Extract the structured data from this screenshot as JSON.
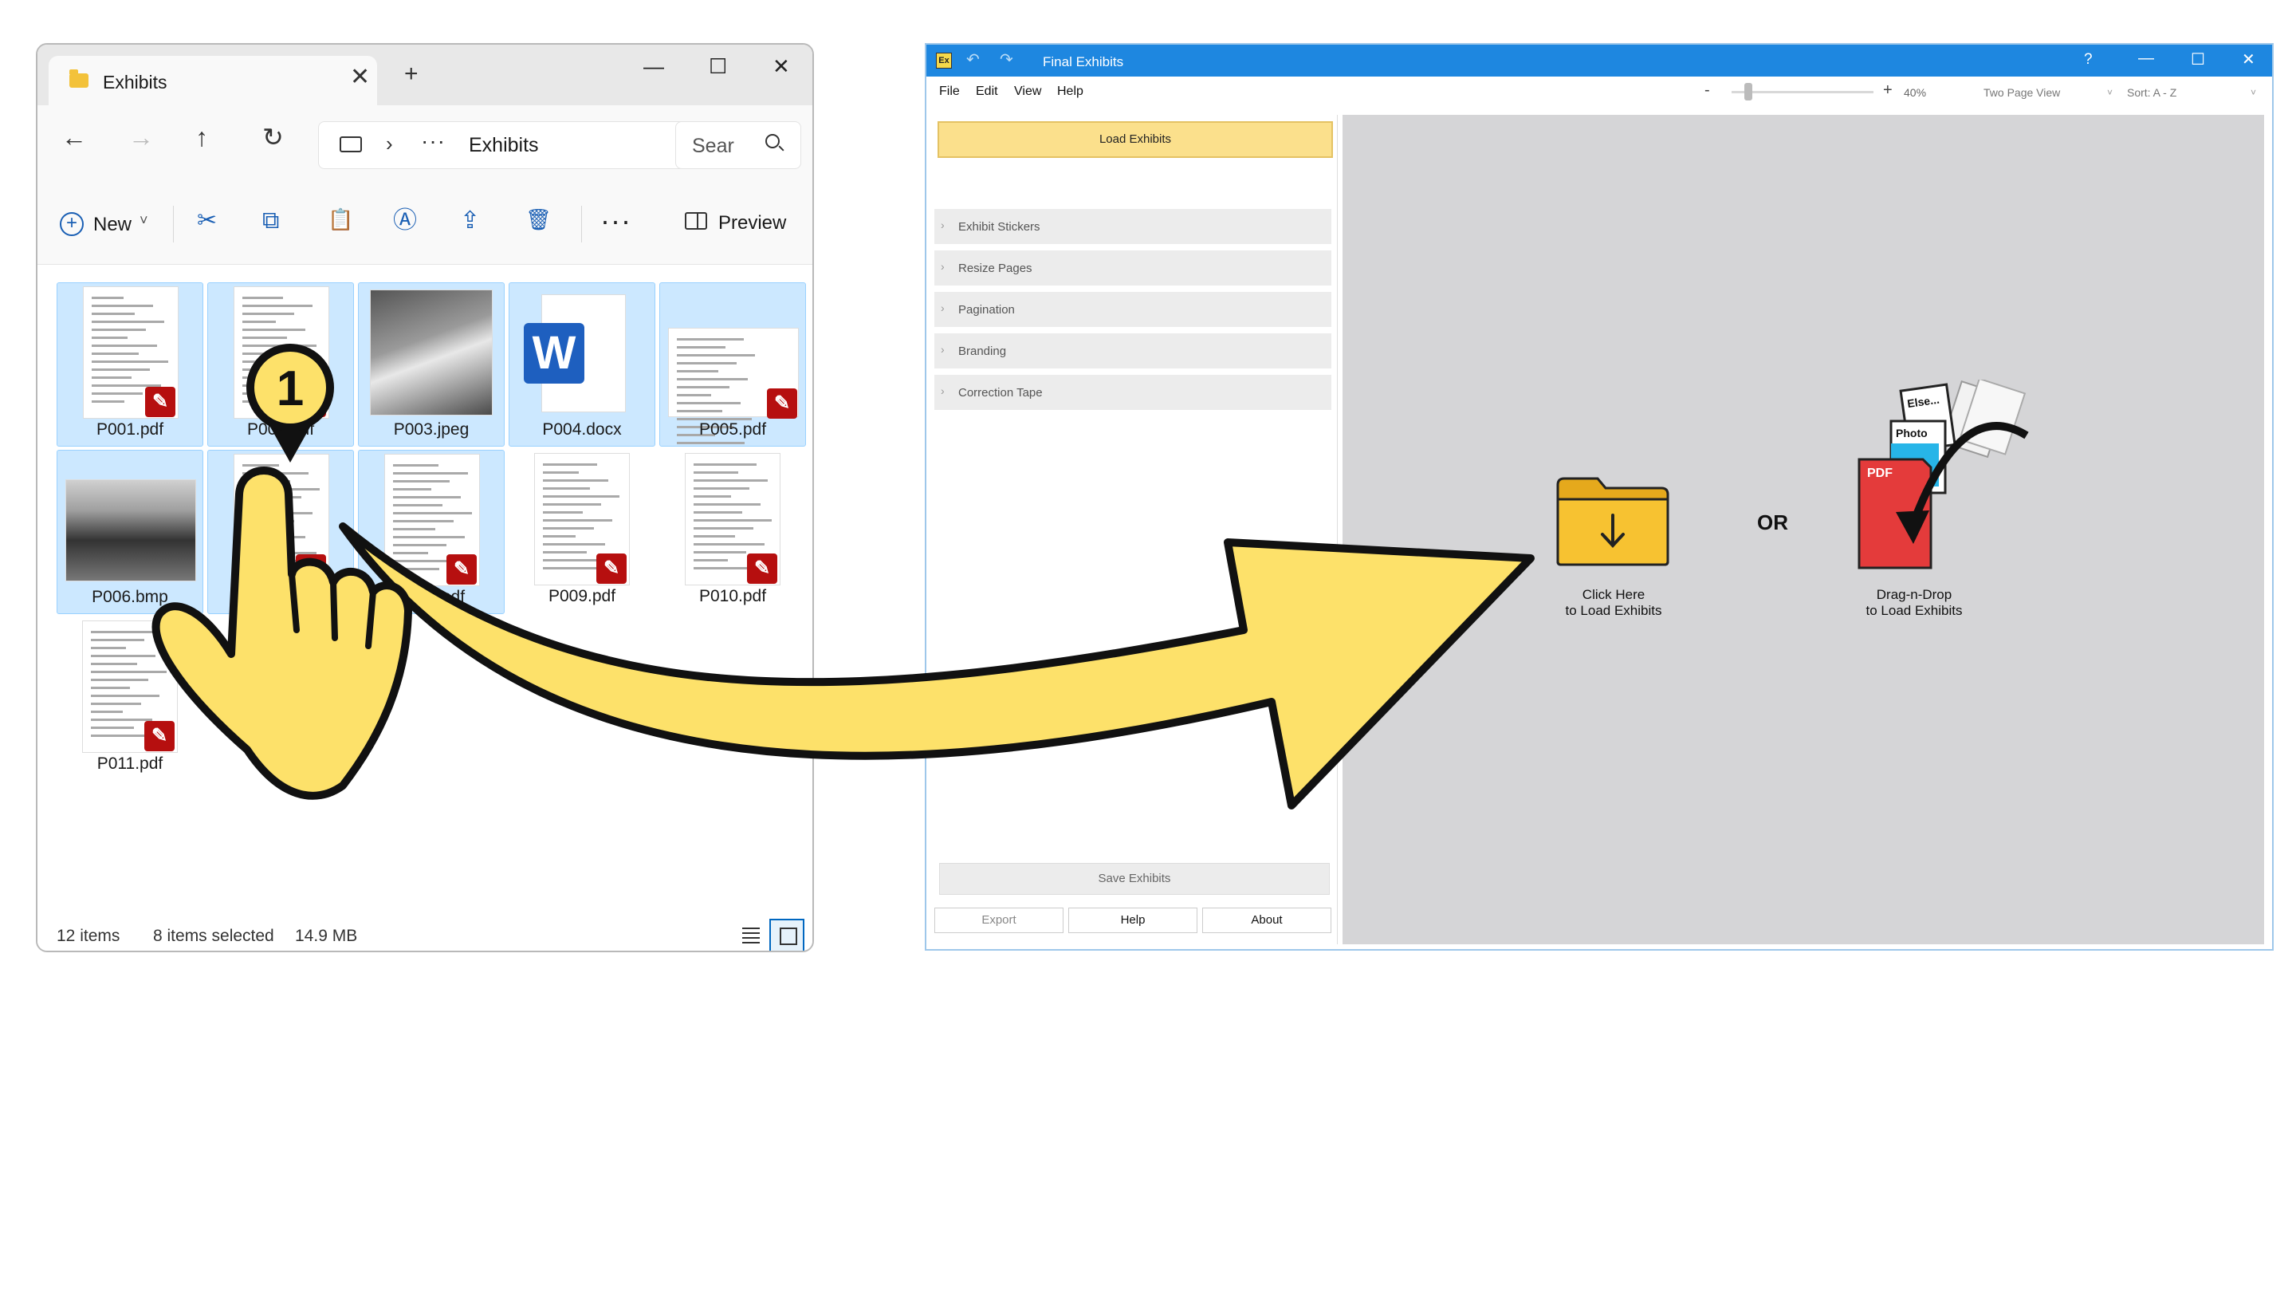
{
  "explorer": {
    "tab_title": "Exhibits",
    "tab_close": "✕",
    "tab_add": "+",
    "window_buttons": {
      "minimize": "—",
      "maximize": "☐",
      "close": "✕"
    },
    "nav": {
      "back": "←",
      "forward": "→",
      "up": "↑",
      "refresh": "↻"
    },
    "address": {
      "chevron": "›",
      "more": "···",
      "folder": "Exhibits"
    },
    "search_placeholder": "Sear",
    "toolbar": {
      "new_icon": "+",
      "new_label": "New",
      "new_chevron": "˅",
      "cut": "✂",
      "copy": "⧉",
      "paste": "📋",
      "rename": "Ⓐ",
      "share": "⇪",
      "delete": "🗑",
      "more": "···",
      "preview_label": "Preview"
    },
    "files": [
      {
        "name": "P001.pdf",
        "type": "pdf",
        "selected": true
      },
      {
        "name": "P002.pdf",
        "type": "pdf",
        "selected": true
      },
      {
        "name": "P003.jpeg",
        "type": "image",
        "selected": true
      },
      {
        "name": "P004.docx",
        "type": "word",
        "selected": true
      },
      {
        "name": "P005.pdf",
        "type": "pdf",
        "selected": true
      },
      {
        "name": "P006.bmp",
        "type": "image",
        "selected": true
      },
      {
        "name": "P007.pdf",
        "type": "pdf",
        "selected": true
      },
      {
        "name": "P008.pdf",
        "type": "pdf",
        "selected": true
      },
      {
        "name": "P009.pdf",
        "type": "pdf",
        "selected": false
      },
      {
        "name": "P010.pdf",
        "type": "pdf",
        "selected": false
      },
      {
        "name": "P011.pdf",
        "type": "pdf",
        "selected": false
      }
    ],
    "status": {
      "count": "12 items",
      "selected": "8 items selected",
      "size": "14.9 MB"
    }
  },
  "finalexhibits": {
    "app_icon": "Ex",
    "title": "Final Exhibits",
    "undo": "↶",
    "redo": "↷",
    "help_q": "?",
    "window_buttons": {
      "minimize": "—",
      "maximize": "☐",
      "close": "✕"
    },
    "menu": [
      "File",
      "Edit",
      "View",
      "Help"
    ],
    "zoom": {
      "minus": "-",
      "plus": "+",
      "percent": "40%",
      "level": 0.1
    },
    "view_mode": "Two Page View",
    "sort": "Sort: A - Z",
    "load_button": "Load Exhibits",
    "sections": [
      "Exhibit Stickers",
      "Resize Pages",
      "Pagination",
      "Branding",
      "Correction Tape"
    ],
    "chevron": "›",
    "save_button": "Save Exhibits",
    "bottom_buttons": {
      "export": "Export",
      "help": "Help",
      "about": "About"
    },
    "click_label_line1": "Click Here",
    "click_label_line2": "to Load Exhibits",
    "or_label": "OR",
    "dnd_label_line1": "Drag-n-Drop",
    "dnd_label_line2": "to Load Exhibits",
    "dnd_cards": {
      "else": "Else...",
      "photo": "Photo",
      "pdf": "PDF"
    }
  },
  "callout": {
    "step_number": "1"
  },
  "colors": {
    "selection": "#cce8ff",
    "accent_blue": "#1e87e0",
    "load_button": "#fbe08c",
    "arrow_fill": "#fde16a",
    "pdf_red": "#b60f0f",
    "folder_yellow": "#f7c231"
  }
}
